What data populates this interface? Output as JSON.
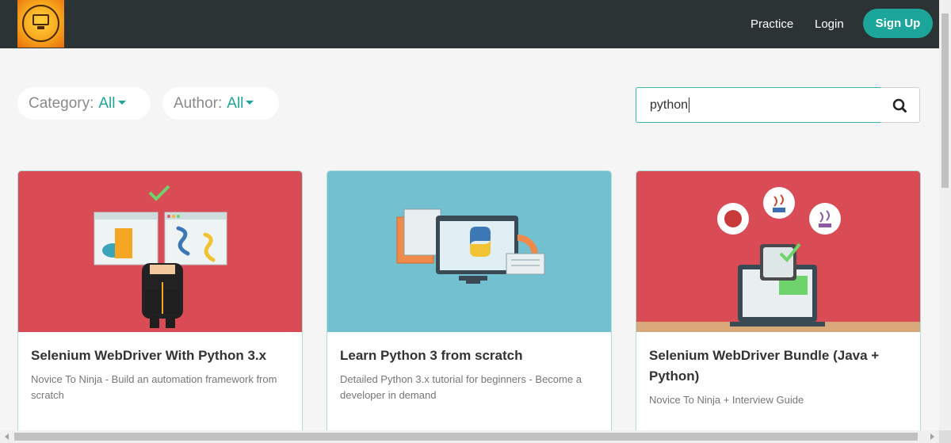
{
  "header": {
    "logo_icon": "brand-logo-icon",
    "nav": [
      {
        "label": "Practice"
      },
      {
        "label": "Login"
      }
    ],
    "signup_label": "Sign Up"
  },
  "filters": {
    "category": {
      "label": "Category:",
      "value": "All"
    },
    "author": {
      "label": "Author:",
      "value": "All"
    }
  },
  "search": {
    "value": "python",
    "button_icon": "search-icon"
  },
  "courses": [
    {
      "title": "Selenium WebDriver With Python 3.x",
      "subtitle": "Novice To Ninja - Build an automation framework from scratch"
    },
    {
      "title": "Learn Python 3 from scratch",
      "subtitle": "Detailed Python 3.x tutorial for beginners - Become a developer in demand"
    },
    {
      "title": "Selenium WebDriver Bundle (Java + Python)",
      "subtitle": "Novice To Ninja + Interview Guide"
    }
  ],
  "colors": {
    "accent": "#1ca69b",
    "navbar": "#2b3335"
  }
}
